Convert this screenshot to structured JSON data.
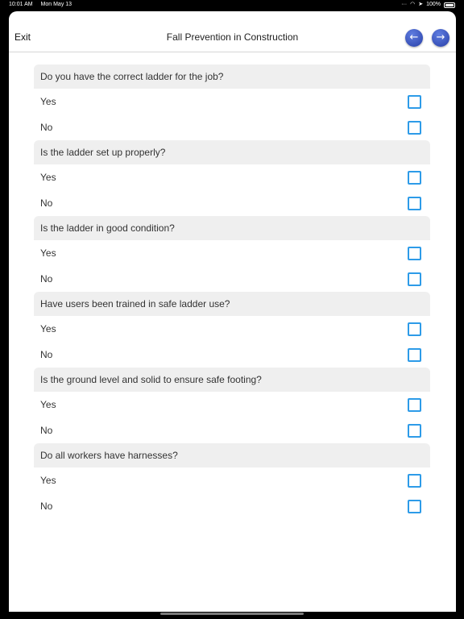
{
  "status_bar": {
    "time": "10:01 AM",
    "date": "Mon May 13",
    "battery": "100%"
  },
  "nav": {
    "exit_label": "Exit",
    "title": "Fall Prevention in Construction",
    "back_icon": "arrow-left-icon",
    "forward_icon": "arrow-right-icon"
  },
  "questions": [
    {
      "text": "Do you have the correct ladder for the job?",
      "options": [
        "Yes",
        "No"
      ]
    },
    {
      "text": "Is the ladder set up properly?",
      "options": [
        "Yes",
        "No"
      ]
    },
    {
      "text": "Is the ladder in good condition?",
      "options": [
        "Yes",
        "No"
      ]
    },
    {
      "text": "Have users been trained in safe ladder use?",
      "options": [
        "Yes",
        "No"
      ]
    },
    {
      "text": "Is the ground level and solid to ensure safe footing?",
      "options": [
        "Yes",
        "No"
      ]
    },
    {
      "text": "Do all workers have harnesses?",
      "options": [
        "Yes",
        "No"
      ]
    }
  ],
  "colors": {
    "checkbox_border": "#2d9be8",
    "nav_button": "#3a55c6",
    "question_bg": "#efefef"
  }
}
